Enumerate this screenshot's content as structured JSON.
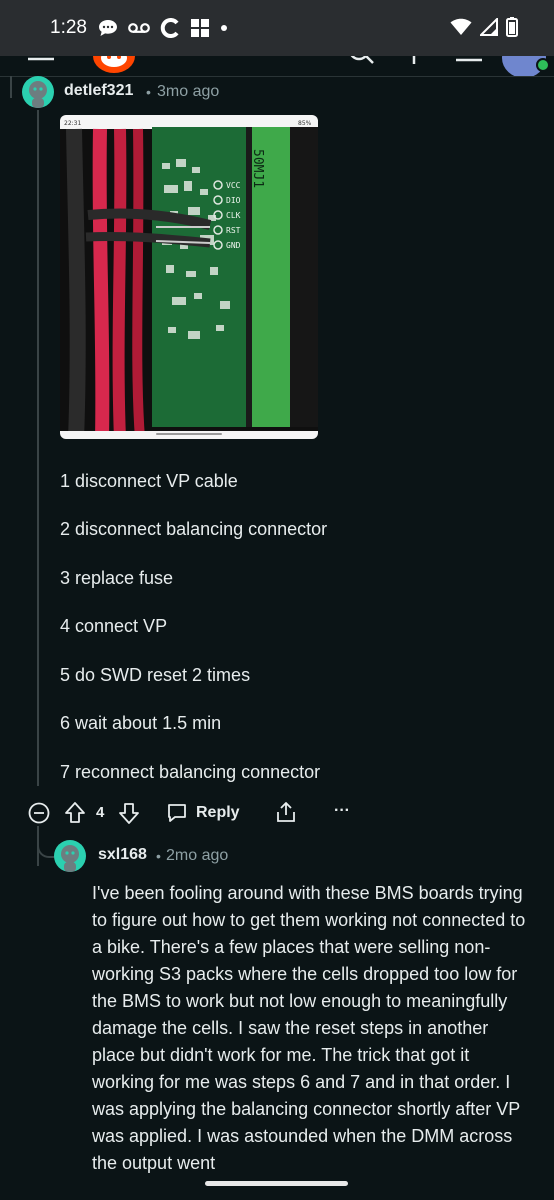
{
  "status_bar": {
    "time": "1:28",
    "left_icons": [
      "chat-bubble-icon",
      "voicemail-icon",
      "c-app-icon",
      "grid-app-icon",
      "dot-icon"
    ],
    "right_icons": [
      "wifi-icon",
      "signal-icon",
      "battery-icon"
    ]
  },
  "comment": {
    "username": "detlef321",
    "separator": "•",
    "time_ago": "3mo ago",
    "image": {
      "status_time": "22:31",
      "status_right": "85%",
      "pin_labels": [
        "VCC",
        "DIO",
        "CLK",
        "RST",
        "GND"
      ],
      "silk_label": "50MJ1"
    },
    "steps": [
      "1 disconnect VP cable",
      "2 disconnect balancing connector",
      "3 replace fuse",
      "4 connect VP",
      "5 do SWD reset 2 times",
      "6 wait about 1.5 min",
      "7 reconnect balancing connector"
    ],
    "actions": {
      "vote_count": "4",
      "reply_label": "Reply",
      "more_label": "···"
    }
  },
  "reply": {
    "username": "sxl168",
    "separator": "•",
    "time_ago": "2mo ago",
    "body": "I've been fooling around with these BMS boards trying to figure out how to get them working not connected to a bike. There's a few places that were selling non-working S3 packs where the cells dropped too low for the BMS to work but not low enough to meaningfully damage the cells. I saw the reset steps in another place but didn't work for me. The trick that got it working for me was steps 6 and 7 and in that order. I was applying the balancing connector shortly after VP was applied. I was astounded when the DMM across the output went"
  },
  "colors": {
    "background": "#0b1416",
    "status_bar": "#2a2d30",
    "avatar": "#2bd0b0",
    "reddit_orange": "#ff4500",
    "text_primary": "#e7eced",
    "text_secondary": "#8ea0a4"
  }
}
